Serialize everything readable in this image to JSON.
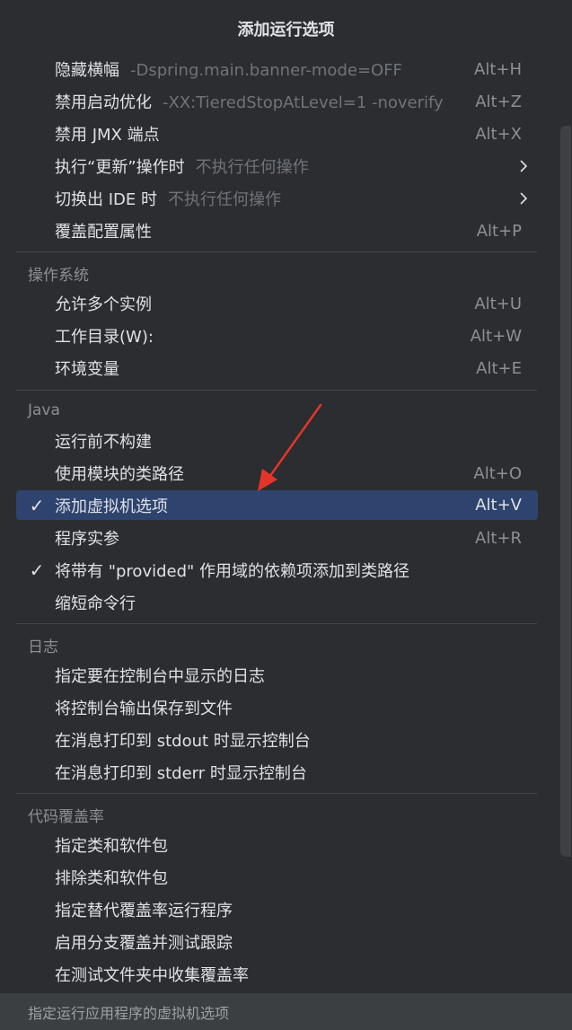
{
  "popup": {
    "title": "添加运行选项"
  },
  "items": {
    "hide_banner": {
      "label": "隐藏横幅",
      "hint": "-Dspring.main.banner-mode=OFF",
      "shortcut": "Alt+H"
    },
    "disable_startup_opt": {
      "label": "禁用启动优化",
      "hint": "-XX:TieredStopAtLevel=1 -noverify",
      "shortcut": "Alt+Z"
    },
    "disable_jmx": {
      "label": "禁用 JMX 端点",
      "shortcut": "Alt+X"
    },
    "on_update": {
      "label": "执行“更新”操作时",
      "hint": "不执行任何操作"
    },
    "on_frame_deactivation": {
      "label": "切换出 IDE 时",
      "hint": "不执行任何操作"
    },
    "override_props": {
      "label": "覆盖配置属性",
      "shortcut": "Alt+P"
    },
    "allow_multiple": {
      "label": "允许多个实例",
      "shortcut": "Alt+U"
    },
    "working_dir": {
      "label": "工作目录(W):",
      "shortcut": "Alt+W"
    },
    "env_vars": {
      "label": "环境变量",
      "shortcut": "Alt+E"
    },
    "no_build": {
      "label": "运行前不构建"
    },
    "module_classpath": {
      "label": "使用模块的类路径",
      "shortcut": "Alt+O"
    },
    "add_vm_options": {
      "label": "添加虚拟机选项",
      "shortcut": "Alt+V",
      "checked": true,
      "check": "✓"
    },
    "program_args": {
      "label": "程序实参",
      "shortcut": "Alt+R"
    },
    "include_provided": {
      "label": "将带有 \"provided\" 作用域的依赖项添加到类路径",
      "checked": true,
      "check": "✓"
    },
    "shorten_cmd": {
      "label": "缩短命令行"
    },
    "logs_to_show": {
      "label": "指定要在控制台中显示的日志"
    },
    "save_console": {
      "label": "将控制台输出保存到文件"
    },
    "show_on_stdout": {
      "label": "在消息打印到 stdout 时显示控制台"
    },
    "show_on_stderr": {
      "label": "在消息打印到 stderr 时显示控制台"
    },
    "specify_classes": {
      "label": "指定类和软件包"
    },
    "exclude_classes": {
      "label": "排除类和软件包"
    },
    "alt_runner": {
      "label": "指定替代覆盖率运行程序"
    },
    "branch_coverage": {
      "label": "启用分支覆盖并测试跟踪"
    },
    "test_folders": {
      "label": "在测试文件夹中收集覆盖率"
    }
  },
  "sections": {
    "os": "操作系统",
    "java": "Java",
    "logs": "日志",
    "coverage": "代码覆盖率"
  },
  "footer": {
    "text": "指定运行应用程序的虚拟机选项"
  },
  "colors": {
    "background": "#2b2d30",
    "selection": "#2e436e",
    "annotation_arrow": "#e5352b"
  }
}
